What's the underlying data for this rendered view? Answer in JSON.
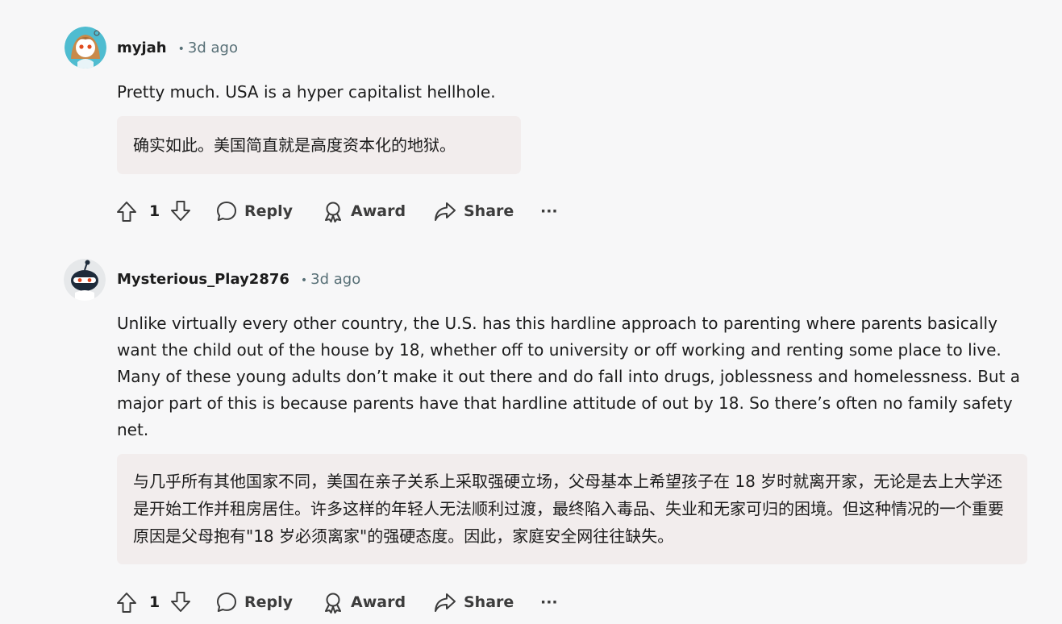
{
  "comments": [
    {
      "author": "myjah",
      "separator": "•",
      "time": "3d ago",
      "text": "Pretty much. USA is a hyper capitalist hellhole.",
      "translation": "确实如此。美国简直就是高度资本化的地狱。",
      "score": "1",
      "avatar_icon": "anime-girl-avatar-icon"
    },
    {
      "author": "Mysterious_Play2876",
      "separator": "•",
      "time": "3d ago",
      "text": "Unlike virtually every other country, the U.S. has this hardline approach to parenting where parents basically want the child out of the house by 18, whether off to university or off working and renting some place to live. Many of these young adults don’t make it out there and do fall into drugs, joblessness and homelessness. But a major part of this is because parents have that hardline attitude of out by 18. So there’s often no family safety net.",
      "translation": "与几乎所有其他国家不同，美国在亲子关系上采取强硬立场，父母基本上希望孩子在 18 岁时就离开家，无论是去上大学还是开始工作并租房居住。许多这样的年轻人无法顺利过渡，最终陷入毒品、失业和无家可归的困境。但这种情况的一个重要原因是父母抱有\"18 岁必须离家\"的强硬态度。因此，家庭安全网往往缺失。",
      "score": "1",
      "avatar_icon": "snoo-ninja-avatar-icon"
    }
  ],
  "actions": {
    "reply": "Reply",
    "award": "Award",
    "share": "Share",
    "more": "···"
  },
  "colors": {
    "background": "#f7f7f8",
    "translation_bg": "#f2eded",
    "meta": "#576f76"
  }
}
